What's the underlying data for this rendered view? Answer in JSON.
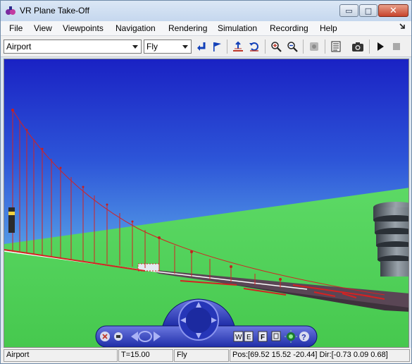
{
  "window": {
    "title": "VR Plane Take-Off",
    "minimize_glyph": "▭",
    "maximize_glyph": "□",
    "close_glyph": "✕"
  },
  "menu": {
    "items": [
      "File",
      "View",
      "Viewpoints",
      "Navigation",
      "Rendering",
      "Simulation",
      "Recording",
      "Help"
    ]
  },
  "toolbar": {
    "viewpoint_select": "Airport",
    "navigation_select": "Fly",
    "icons": [
      "return-viewpoint-icon",
      "create-viewpoint-icon",
      "straighten-up-icon",
      "undo-move-icon",
      "zoom-in-icon",
      "zoom-out-icon",
      "stop-icon",
      "scene-tree-icon",
      "screenshot-icon",
      "play-icon",
      "record-stop-icon"
    ]
  },
  "nav_panel": {
    "w_label": "W",
    "e_label": "E",
    "f_label": "F",
    "help_label": "?"
  },
  "status": {
    "viewpoint": "Airport",
    "time": "T=15.00",
    "mode": "Fly",
    "position": "Pos:[69.52 15.52 -20.44] Dir:[-0.73 0.09 0.68]"
  },
  "colors": {
    "sky_top": "#1d2fc9",
    "sky_bottom": "#7fd0ef",
    "ground": "#4fd35a",
    "runway": "#4a3a48",
    "cable": "#d42222"
  }
}
